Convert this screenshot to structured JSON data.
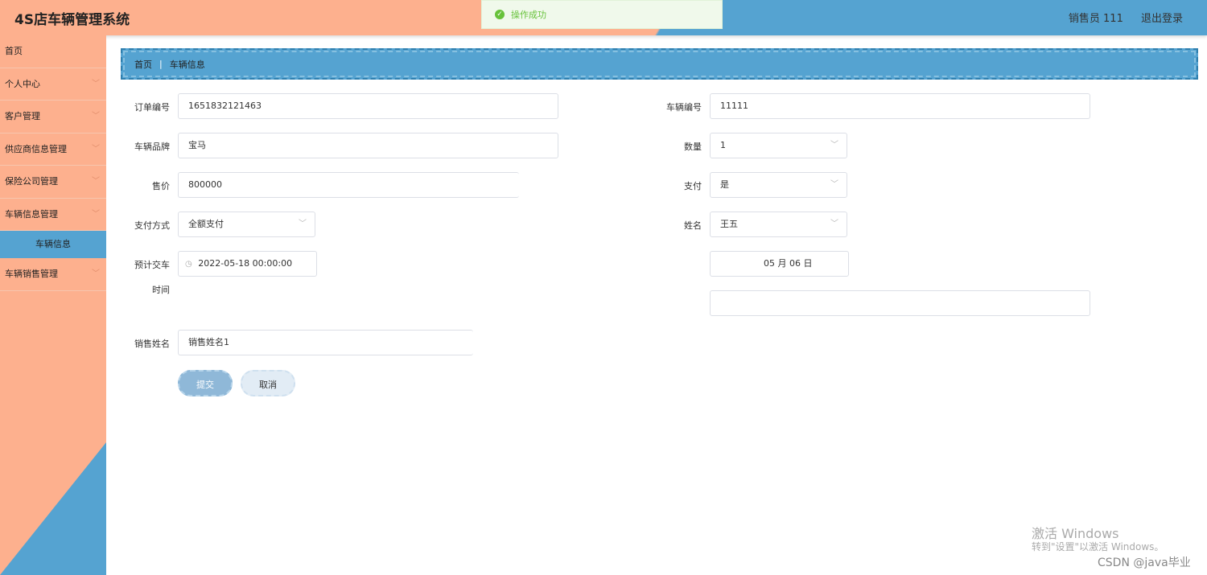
{
  "header": {
    "title": "4S店车辆管理系统",
    "user": "销售员 111",
    "logout": "退出登录"
  },
  "toast": {
    "message": "操作成功"
  },
  "sidebar": {
    "items": [
      {
        "label": "首页",
        "chevron": ""
      },
      {
        "label": "个人中心",
        "chevron": "﹀"
      },
      {
        "label": "客户管理",
        "chevron": "﹀"
      },
      {
        "label": "供应商信息管理",
        "chevron": "﹀"
      },
      {
        "label": "保险公司管理",
        "chevron": "﹀"
      },
      {
        "label": "车辆信息管理",
        "chevron": "﹀"
      }
    ],
    "active_sub": "车辆信息",
    "last_item": {
      "label": "车辆销售管理",
      "chevron": "﹀"
    }
  },
  "breadcrumb": {
    "home": "首页",
    "separator": "|",
    "current": "车辆信息"
  },
  "form": {
    "order_no": {
      "label": "订单编号",
      "value": "1651832121463"
    },
    "vehicle_no": {
      "label": "车辆编号",
      "value": "11111"
    },
    "brand": {
      "label": "车辆品牌",
      "value": "宝马"
    },
    "quantity": {
      "label": "数量",
      "value": "1"
    },
    "price": {
      "label": "售价",
      "value": "800000"
    },
    "paid": {
      "label": "支付",
      "value": "是"
    },
    "pay_method": {
      "label": "支付方式",
      "value": "全额支付"
    },
    "customer_name": {
      "label": "姓名",
      "value": "王五"
    },
    "delivery_time": {
      "label_line1": "预计交车",
      "label_line2": "时间",
      "value": "2022-05-18 00:00:00"
    },
    "partial_date": {
      "value": "05 月 06 日"
    },
    "sales_name": {
      "label": "销售姓名",
      "value": "销售姓名1"
    }
  },
  "buttons": {
    "submit": "提交",
    "cancel": "取消"
  },
  "icons": {
    "success": "check-circle-icon",
    "caret": "chevron-down-icon",
    "clock": "clock-icon"
  },
  "watermark": {
    "line1": "激活 Windows",
    "line2": "转到\"设置\"以激活 Windows。",
    "credit": "CSDN @java毕业"
  },
  "colors": {
    "peach": "#fdb08e",
    "blue": "#55a3d1",
    "success": "#67c23a"
  }
}
